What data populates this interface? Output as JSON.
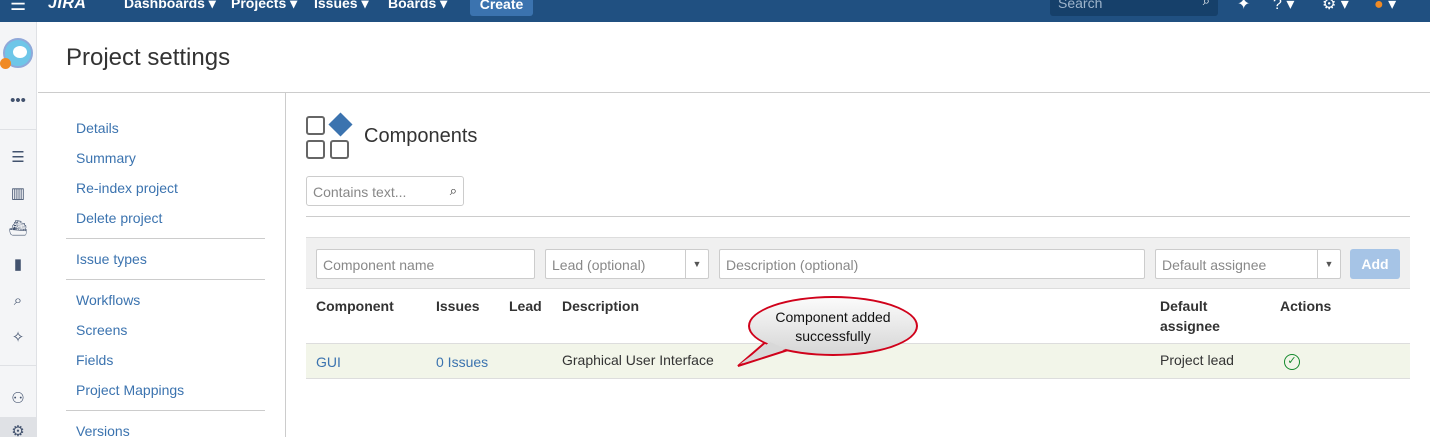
{
  "topnav": {
    "menu_icon": "hamburger-icon",
    "logo": "JIRA",
    "items": [
      "Dashboards",
      "Projects",
      "Issues",
      "Boards"
    ],
    "create_label": "Create",
    "search_placeholder": "Search",
    "icons": [
      "search-icon",
      "feedback-icon",
      "help-icon",
      "gear-icon",
      "user-avatar"
    ]
  },
  "page_title": "Project settings",
  "settings_nav": {
    "items": [
      "Details",
      "Summary",
      "Re-index project",
      "Delete project",
      "Issue types",
      "Workflows",
      "Screens",
      "Fields",
      "Project Mappings",
      "Versions"
    ]
  },
  "main": {
    "title": "Components",
    "filter_placeholder": "Contains text...",
    "add_form": {
      "name_placeholder": "Component name",
      "lead_placeholder": "Lead (optional)",
      "description_placeholder": "Description (optional)",
      "assignee_placeholder": "Default assignee",
      "add_label": "Add"
    },
    "table": {
      "headers": [
        "Component",
        "Issues",
        "Lead",
        "Description",
        "Default",
        "assignee",
        "Actions"
      ],
      "rows": [
        {
          "component": "GUI",
          "issues": "0 Issues",
          "lead": "",
          "description": "Graphical User Interface",
          "default_assignee": "Project lead",
          "action_icon": "check-circle-icon"
        }
      ]
    }
  },
  "callout": {
    "line1": "Component added",
    "line2": "successfully"
  },
  "colors": {
    "nav_bg": "#205081",
    "link": "#3b73af",
    "callout_border": "#d0021b",
    "success": "#14892c"
  }
}
